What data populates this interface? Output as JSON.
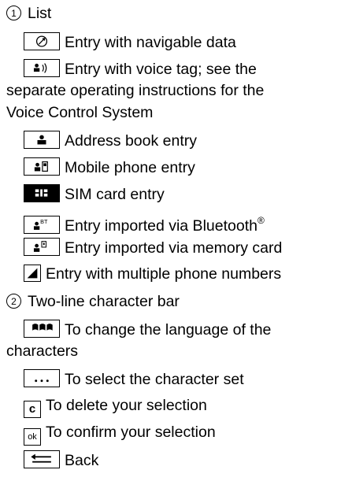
{
  "section1": {
    "number": "1",
    "title": "List",
    "items": [
      {
        "icon": "navigable-data-icon",
        "text": "Entry with navigable data"
      },
      {
        "icon": "voice-tag-icon",
        "text": "Entry with voice tag; see the",
        "cont": [
          "separate operating instructions for the",
          "Voice Control System"
        ]
      },
      {
        "icon": "address-book-icon",
        "text": "Address book entry"
      },
      {
        "icon": "mobile-phone-icon",
        "text": "Mobile phone entry"
      },
      {
        "icon": "sim-card-icon",
        "text": "SIM card entry"
      },
      {
        "icon": "bluetooth-import-icon",
        "text": "Entry imported via Bluetooth",
        "sup": "®"
      },
      {
        "icon": "memory-card-import-icon",
        "text": "Entry imported via memory card"
      },
      {
        "icon": "multiple-numbers-icon",
        "text": "Entry with multiple phone numbers"
      }
    ]
  },
  "section2": {
    "number": "2",
    "title": "Two-line character bar",
    "items": [
      {
        "icon": "language-flags-icon",
        "text": "To change the language of the",
        "cont": [
          "characters"
        ]
      },
      {
        "icon": "character-set-icon",
        "text": "To select the character set"
      },
      {
        "icon": "delete-icon",
        "text": "To delete your selection",
        "icon_text": "c"
      },
      {
        "icon": "confirm-icon",
        "text": "To confirm your selection",
        "icon_text": "ok"
      },
      {
        "icon": "back-icon",
        "text": "Back"
      }
    ]
  }
}
